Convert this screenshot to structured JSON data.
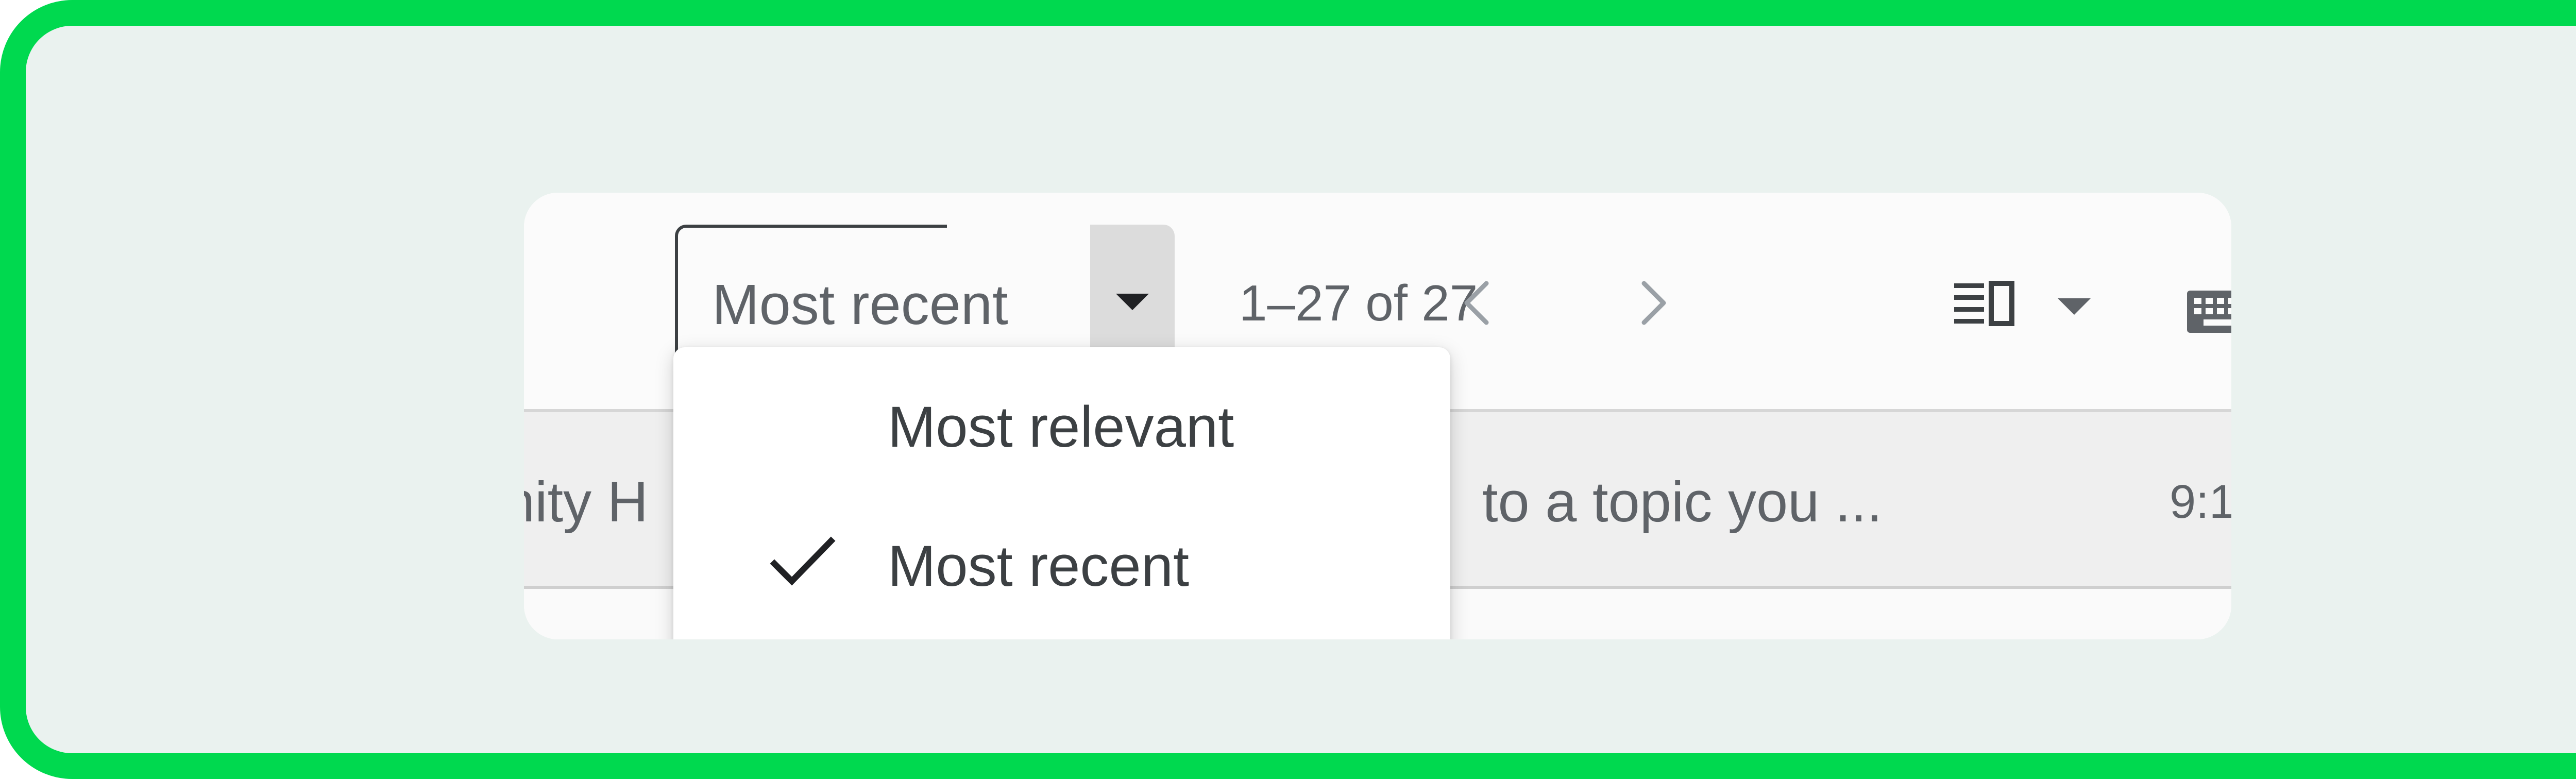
{
  "sort_control": {
    "current_label": "Most recent",
    "dropdown_icon": "caret-down-icon"
  },
  "pagination": {
    "range_text": "1–27 of 27",
    "prev_icon": "chevron-left-icon",
    "next_icon": "chevron-right-icon"
  },
  "toolbar_icons": {
    "layout_icon": "split-pane-icon",
    "layout_dropdown_icon": "caret-down-icon",
    "keyboard_icon": "keyboard-icon"
  },
  "email_row": {
    "sender_fragment": "nity H",
    "snippet_fragment": "to a topic you ...",
    "time_fragment": "9:1"
  },
  "sort_menu": {
    "items": [
      {
        "label": "Most relevant",
        "selected": false
      },
      {
        "label": "Most recent",
        "selected": true
      }
    ],
    "check_icon": "checkmark-icon"
  },
  "colors": {
    "outer_border": "#00d94f",
    "outer_background": "#eaf2ef",
    "text_secondary": "#5f6368",
    "menu_text": "#3c4043"
  }
}
